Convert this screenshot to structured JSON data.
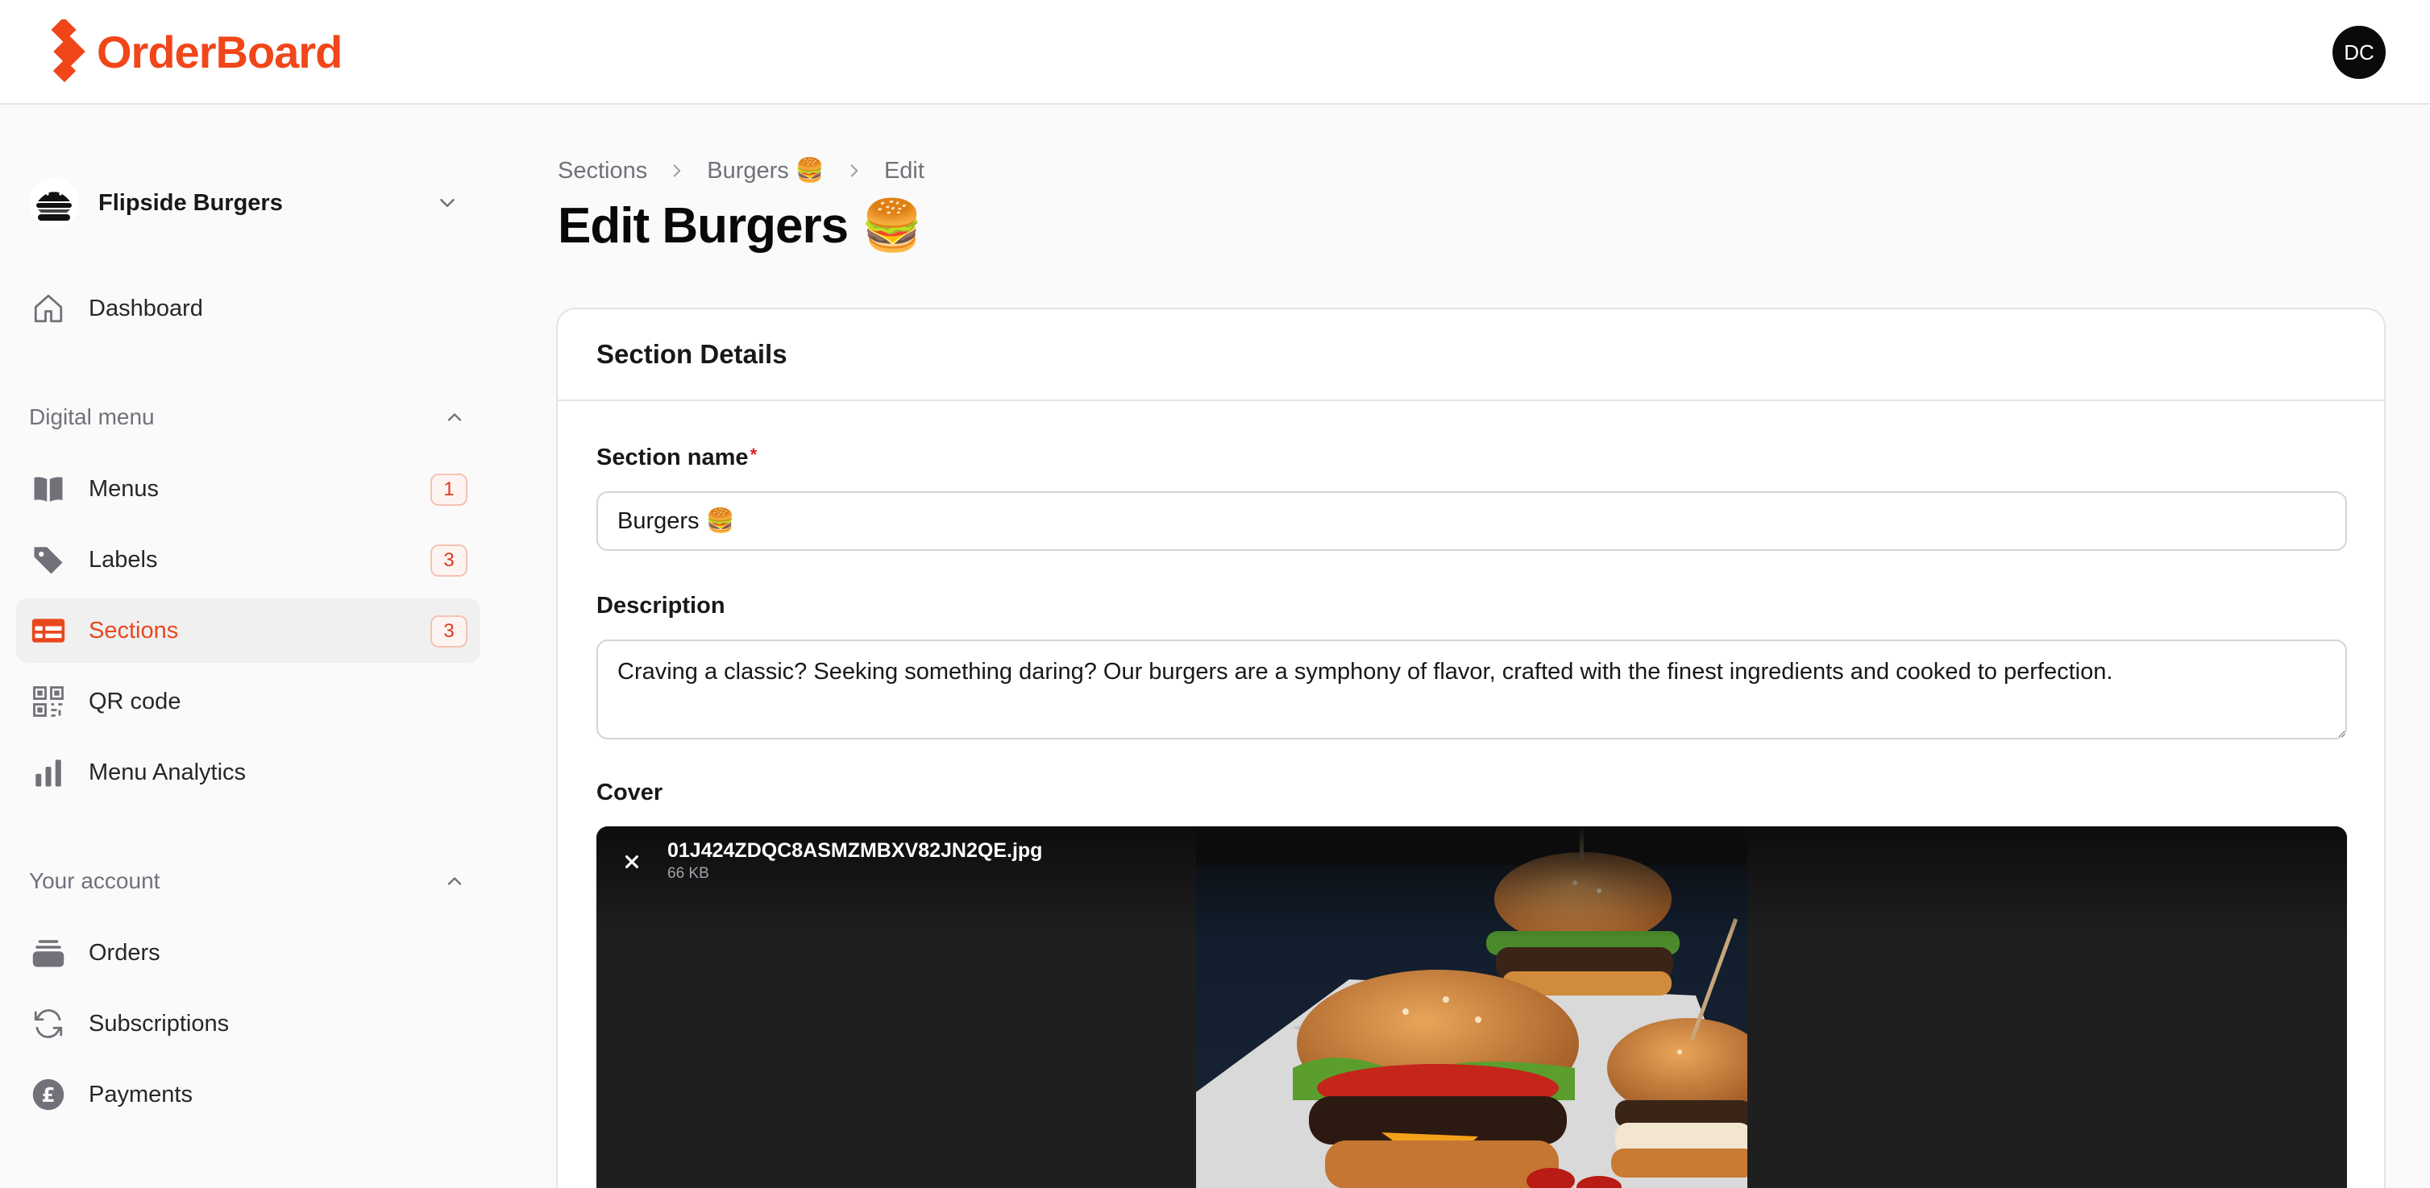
{
  "app": {
    "name": "OrderBoard",
    "brand_color": "#f0461a"
  },
  "user": {
    "initials": "DC"
  },
  "team": {
    "name": "Flipside Burgers"
  },
  "nav": {
    "dashboard": "Dashboard",
    "digital_menu_group": "Digital menu",
    "items": [
      {
        "label": "Menus",
        "badge": "1",
        "icon": "book-icon"
      },
      {
        "label": "Labels",
        "badge": "3",
        "icon": "tag-icon"
      },
      {
        "label": "Sections",
        "badge": "3",
        "icon": "table-icon",
        "active": true
      },
      {
        "label": "QR code",
        "icon": "qr-code-icon"
      },
      {
        "label": "Menu Analytics",
        "icon": "bar-chart-icon"
      }
    ],
    "account_group": "Your account",
    "account_items": [
      {
        "label": "Orders",
        "icon": "stack-icon"
      },
      {
        "label": "Subscriptions",
        "icon": "refresh-icon"
      },
      {
        "label": "Payments",
        "icon": "pound-icon"
      }
    ]
  },
  "breadcrumb": [
    "Sections",
    "Burgers 🍔",
    "Edit"
  ],
  "page": {
    "title": "Edit Burgers 🍔"
  },
  "form": {
    "card_title": "Section Details",
    "section_name_label": "Section name",
    "required_mark": "*",
    "section_name_value": "Burgers 🍔",
    "description_label": "Description",
    "description_value": "Craving a classic? Seeking something daring? Our burgers are a symphony of flavor, crafted with the finest ingredients and cooked to perfection.",
    "cover_label": "Cover",
    "cover_file_name": "01J424ZDQC8ASMZMBXV82JN2QE.jpg",
    "cover_file_size": "66 KB"
  }
}
